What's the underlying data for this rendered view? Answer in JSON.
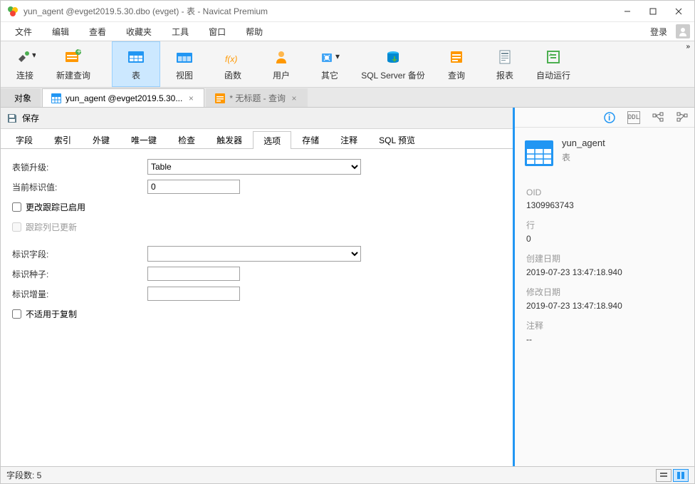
{
  "window": {
    "title": "yun_agent @evget2019.5.30.dbo (evget) - 表 - Navicat Premium"
  },
  "menu": {
    "items": [
      "文件",
      "编辑",
      "查看",
      "收藏夹",
      "工具",
      "窗口",
      "帮助"
    ],
    "login": "登录"
  },
  "ribbon": {
    "items": [
      {
        "label": "连接",
        "icon": "plug-icon"
      },
      {
        "label": "新建查询",
        "icon": "new-query-icon"
      },
      {
        "label": "表",
        "icon": "table-icon",
        "active": true
      },
      {
        "label": "视图",
        "icon": "view-icon"
      },
      {
        "label": "函数",
        "icon": "function-icon"
      },
      {
        "label": "用户",
        "icon": "user-icon"
      },
      {
        "label": "其它",
        "icon": "other-icon"
      },
      {
        "label": "SQL Server 备份",
        "icon": "backup-icon"
      },
      {
        "label": "查询",
        "icon": "query-icon"
      },
      {
        "label": "报表",
        "icon": "report-icon"
      },
      {
        "label": "自动运行",
        "icon": "automation-icon"
      }
    ]
  },
  "doctabs": [
    {
      "label": "对象",
      "icon": "object-icon"
    },
    {
      "label": "yun_agent @evget2019.5.30...",
      "icon": "table-icon",
      "active": true
    },
    {
      "label": "* 无标题 - 查询",
      "icon": "query-icon",
      "starred": true
    }
  ],
  "savebar": {
    "label": "保存"
  },
  "proptabs": [
    "字段",
    "索引",
    "外键",
    "唯一键",
    "检查",
    "触发器",
    "选项",
    "存储",
    "注释",
    "SQL 预览"
  ],
  "proptabs_active_index": 6,
  "form": {
    "lock_escalation": {
      "label": "表锁升级:",
      "value": "Table"
    },
    "current_identity": {
      "label": "当前标识值:",
      "value": "0"
    },
    "change_tracking_enabled": {
      "label": "更改跟踪已启用",
      "checked": false
    },
    "track_columns_updated": {
      "label": "跟踪列已更新",
      "checked": false,
      "disabled": true
    },
    "identity_field": {
      "label": "标识字段:",
      "value": ""
    },
    "identity_seed": {
      "label": "标识种子:",
      "value": ""
    },
    "identity_increment": {
      "label": "标识增量:",
      "value": ""
    },
    "not_for_replication": {
      "label": "不适用于复制",
      "checked": false
    }
  },
  "rpanel": {
    "name": "yun_agent",
    "sub": "表",
    "sections": [
      {
        "label": "OID",
        "value": "1309963743"
      },
      {
        "label": "行",
        "value": "0"
      },
      {
        "label": "创建日期",
        "value": "2019-07-23 13:47:18.940"
      },
      {
        "label": "修改日期",
        "value": "2019-07-23 13:47:18.940"
      },
      {
        "label": "注释",
        "value": "--"
      }
    ]
  },
  "statusbar": {
    "text": "字段数: 5"
  }
}
